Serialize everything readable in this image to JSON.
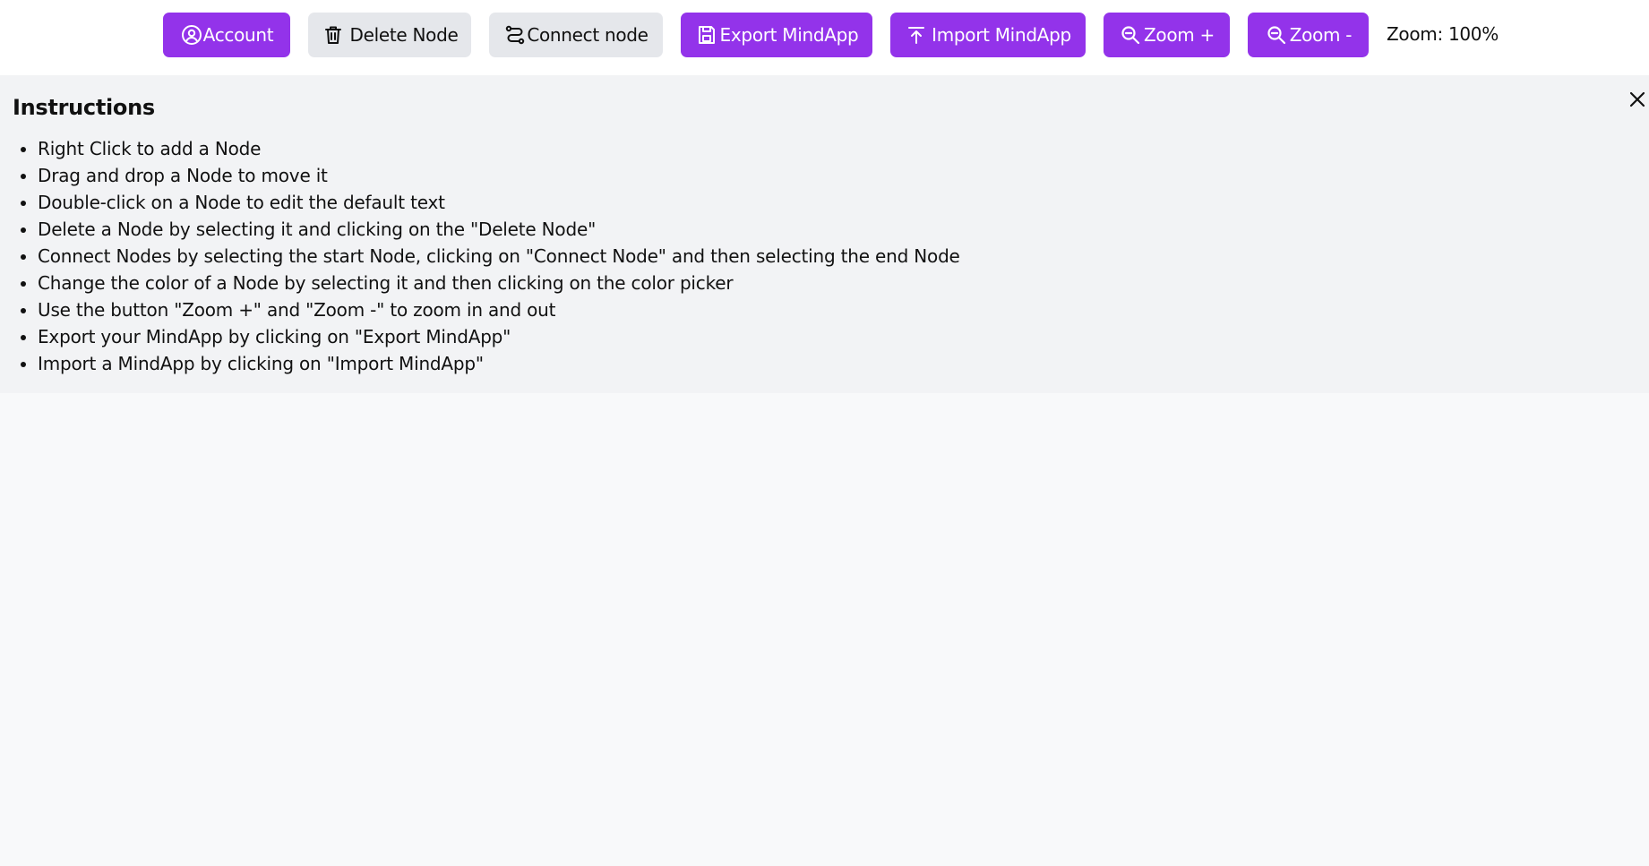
{
  "toolbar": {
    "account_label": "Account",
    "delete_node_label": "Delete Node",
    "connect_node_label": "Connect node",
    "export_label": "Export MindApp",
    "import_label": "Import MindApp",
    "zoom_in_label": "Zoom +",
    "zoom_out_label": "Zoom -",
    "zoom_status": "Zoom: 100%",
    "icons": {
      "account": "user-circle-icon",
      "delete": "trash-icon",
      "connect": "connect-route-icon",
      "export": "save-floppy-icon",
      "import": "upload-arrow-icon",
      "zoom_in": "magnify-icon",
      "zoom_out": "magnify-icon"
    }
  },
  "instructions": {
    "title": "Instructions",
    "close_icon": "close-icon",
    "items": [
      "Right Click to add a Node",
      "Drag and drop a Node to move it",
      "Double-click on a Node to edit the default text",
      "Delete a Node by selecting it and clicking on the \"Delete Node\"",
      "Connect Nodes by selecting the start Node, clicking on \"Connect Node\" and then selecting the end Node",
      "Change the color of a Node by selecting it and then clicking on the color picker",
      "Use the button \"Zoom +\" and \"Zoom -\" to zoom in and out",
      "Export your MindApp by clicking on \"Export MindApp\"",
      "Import a MindApp by clicking on \"Import MindApp\""
    ]
  },
  "colors": {
    "primary": "#9333ea",
    "secondary": "#e5e7eb",
    "panel": "#f2f3f5",
    "canvas": "#f8f9fa"
  }
}
